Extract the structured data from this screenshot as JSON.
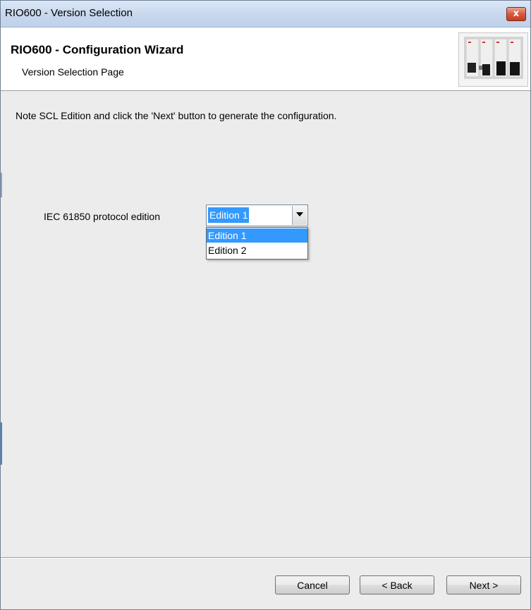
{
  "window": {
    "title": "RIO600 - Version Selection",
    "close_glyph": "x"
  },
  "header": {
    "title": "RIO600 - Configuration Wizard",
    "subtitle": "Version Selection Page",
    "image": "device-image"
  },
  "main": {
    "note": "Note SCL Edition and click the 'Next' button to generate the configuration.",
    "edition_label": "IEC 61850 protocol edition",
    "edition_value": "Edition 1",
    "edition_options": [
      "Edition 1",
      "Edition 2"
    ],
    "selected_option_index": 0
  },
  "footer": {
    "cancel_label": "Cancel",
    "back_label": "< Back",
    "next_label": "Next >"
  },
  "colors": {
    "selection": "#3399ff",
    "titlebar": "#c7d7ed",
    "close": "#c23f22"
  }
}
